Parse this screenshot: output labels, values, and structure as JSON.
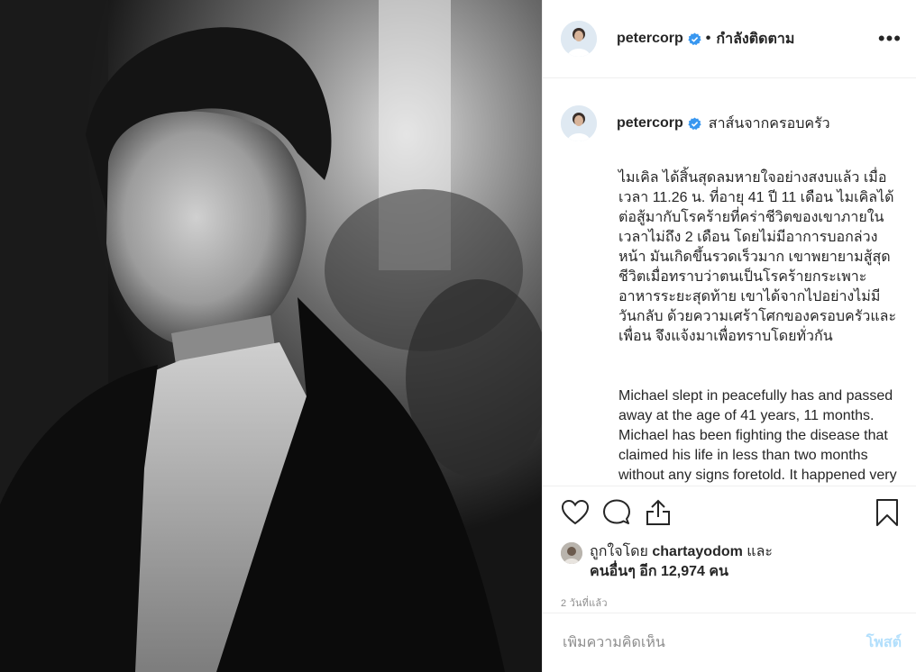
{
  "account": {
    "username": "petercorp",
    "follow_state": "กำลังติดตาม",
    "dot": "•",
    "more": "•••"
  },
  "caption": {
    "title": "สาส์นจากครอบครัว",
    "thai": "ไมเคิล ได้สิ้นสุดลมหายใจอย่างสงบแล้ว เมื่อเวลา 11.26 น. ที่อายุ 41 ปี 11 เดือน ไมเคิลได้ต่อสู้มากับโรคร้ายที่คร่าชีวิตของเขาภายในเวลาไม่ถึง 2 เดือน โดยไม่มีอาการบอกล่วงหน้า มันเกิดขึ้นรวดเร็วมาก เขาพยายามสู้สุดชีวิตเมื่อทราบว่าตนเป็นโรคร้ายกระเพาะอาหารระยะสุดท้าย เขาได้จากไปอย่างไม่มีวันกลับ ด้วยความเศร้าโศกของครอบครัวและเพื่อน จึงแจ้งมาเพื่อทราบโดยทั่วกัน",
    "english": "Michael slept in peacefully has and passed away at the age of 41 years, 11 months. Michael has been fighting the disease that claimed his life in less than two months without any signs foretold. It happened very fast . He"
  },
  "likes": {
    "prefix": "ถูกใจโดย",
    "user": "chartayodom",
    "and": "และ",
    "others": "คนอื่นๆ อีก 12,974 คน"
  },
  "timestamp": "2 วันที่แล้ว",
  "comment_box": {
    "placeholder": "เพิ่มความคิดเห็น",
    "post_label": "โพสต์"
  },
  "colors": {
    "verified": "#3897f0",
    "post_disabled": "#b2dffc",
    "muted": "#8e8e8e",
    "text": "#262626"
  },
  "icons": [
    "heart-icon",
    "comment-icon",
    "share-icon",
    "bookmark-icon",
    "verified-badge-icon",
    "more-options-icon"
  ]
}
